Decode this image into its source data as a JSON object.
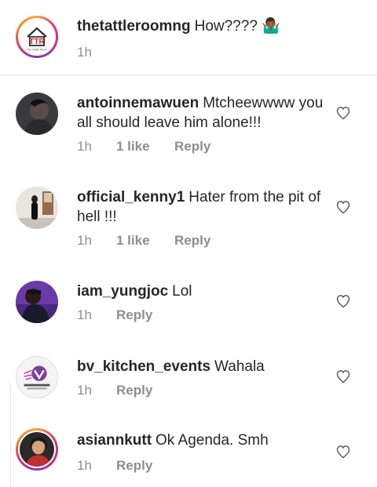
{
  "caption": {
    "username": "thetattleroomng",
    "text": "How???? 🤷🏾‍♂️",
    "time": "1h",
    "avatar_logo": "TTR",
    "avatar_subtext": "The Tattle Room"
  },
  "comments": [
    {
      "username": "antoinnemawuen",
      "text": "Mtcheewwww you all should leave him alone!!!",
      "time": "1h",
      "likes": "1 like",
      "reply": "Reply",
      "icon": "heart-outline-icon"
    },
    {
      "username": "official_kenny1",
      "text": "Hater from the pit of hell !!!",
      "time": "1h",
      "likes": "1 like",
      "reply": "Reply",
      "icon": "heart-outline-icon"
    },
    {
      "username": "iam_yungjoc",
      "text": "Lol",
      "time": "1h",
      "likes": "",
      "reply": "Reply",
      "icon": "heart-outline-icon"
    },
    {
      "username": "bv_kitchen_events",
      "text": "Wahala",
      "time": "1h",
      "likes": "",
      "reply": "Reply",
      "icon": "heart-outline-icon"
    },
    {
      "username": "asiannkutt",
      "text": "Ok Agenda. Smh",
      "time": "1h",
      "likes": "",
      "reply": "Reply",
      "icon": "heart-outline-icon"
    }
  ],
  "colors": {
    "text": "#262626",
    "meta": "#8e8e8e",
    "divider": "#e3e3e3",
    "story_ring": "#e1306c"
  }
}
